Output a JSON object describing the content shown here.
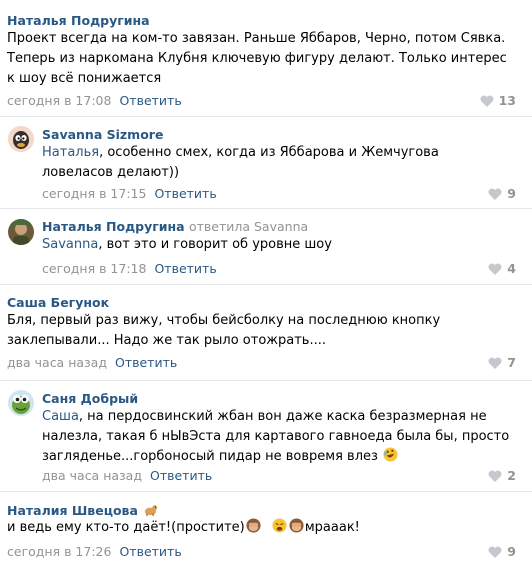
{
  "comments": [
    {
      "author": "Наталья Подругина",
      "text": "Проект всегда на ком-то завязан. Раньше Яббаров, Черно, потом Сявка. Теперь из наркомана Клубня ключевую фигуру делают. Только интерес к шоу всё понижается",
      "time": "сегодня в 17:08",
      "reply_label": "Ответить",
      "likes": "13"
    },
    {
      "author": "Savanna Sizmore",
      "mention": "Наталья",
      "text": ", особенно смех, когда из Яббарова и Жемчугова ловеласов делают))",
      "time": "сегодня в 17:15",
      "reply_label": "Ответить",
      "likes": "9"
    },
    {
      "author": "Наталья Подругина",
      "replied_to": "ответила Savanna",
      "mention": "Savanna",
      "text": ", вот это и говорит об уровне шоу",
      "time": "сегодня в 17:18",
      "reply_label": "Ответить",
      "likes": "4"
    },
    {
      "author": "Саша Бегунок",
      "text": "Бля, первый раз вижу, чтобы бейсболку на последнюю кнопку заклепывали... Надо же так рыло отожрать....",
      "time": "два часа назад",
      "reply_label": "Ответить",
      "likes": "7"
    },
    {
      "author": "Саня Добрый",
      "mention": "Саша",
      "text": ", на пердосвинский жбан вон даже каска безразмерная не налезла, такая б нЫвЭста для картавого гавноеда была бы, просто загляденье...горбоносый пидар не вовремя влез",
      "time": "два часа назад",
      "reply_label": "Ответить",
      "likes": "2"
    },
    {
      "author": "Наталия Швецова",
      "text_a": "и ведь ему кто-то даёт!(простите)",
      "text_b": "мрааак!",
      "time": "сегодня в 17:26",
      "reply_label": "Ответить",
      "likes": "9"
    }
  ],
  "icons": {
    "like": "heart-icon",
    "emoji_author_badge": "dog-emoji-icon",
    "emoji_laugh": "rolling-laughing-emoji-icon",
    "emoji_monkey": "see-no-evil-monkey-emoji-icon",
    "emoji_tired": "tired-face-emoji-icon"
  },
  "colors": {
    "link": "#2a5885",
    "secondary": "#939393",
    "divider": "#e7e8ec"
  }
}
